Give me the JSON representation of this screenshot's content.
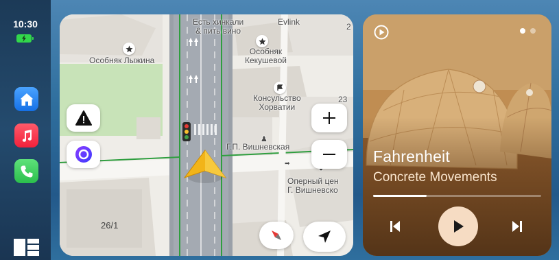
{
  "status": {
    "time": "10:30",
    "battery_state": "charging",
    "battery_color": "#32d74b"
  },
  "dock": {
    "apps": [
      {
        "name": "home",
        "icon": "house-icon",
        "color": "#1e7cf0"
      },
      {
        "name": "music",
        "icon": "music-note-icon",
        "color": "#f2213b"
      },
      {
        "name": "phone",
        "icon": "phone-icon",
        "color": "#2bbf4c"
      }
    ],
    "dashboard_icon": "dashboard-grid-icon"
  },
  "map": {
    "labels": {
      "khinkali": "Есть хинкали\n& пить вино",
      "evlink": "Evlink",
      "lyzhina": "Особняк Лыжина",
      "kekusheva": "Особняк\nКекушевой",
      "horvatii": "Консульство\nХорватии",
      "vishnevskaya": "Г.П. Вишневская",
      "opera": "Оперный цен\nГ. Вишневско",
      "edge_2": "2",
      "edge_23": "23",
      "house_number": "26/1"
    },
    "route_color": "#2f9e3f",
    "buttons": {
      "alert": "alert-triangle-icon",
      "alice": "alice-assistant-icon",
      "zoom_in": "plus-icon",
      "zoom_out": "minus-icon",
      "compass": "compass-icon",
      "locate": "navigation-arrow-icon"
    }
  },
  "now_playing": {
    "title": "Fahrenheit",
    "artist": "Concrete Movements",
    "progress_fraction": 0.32,
    "page_count": 2,
    "active_page": 0,
    "source_icon": "play-circle-icon",
    "accent": "#f6dcc3"
  }
}
